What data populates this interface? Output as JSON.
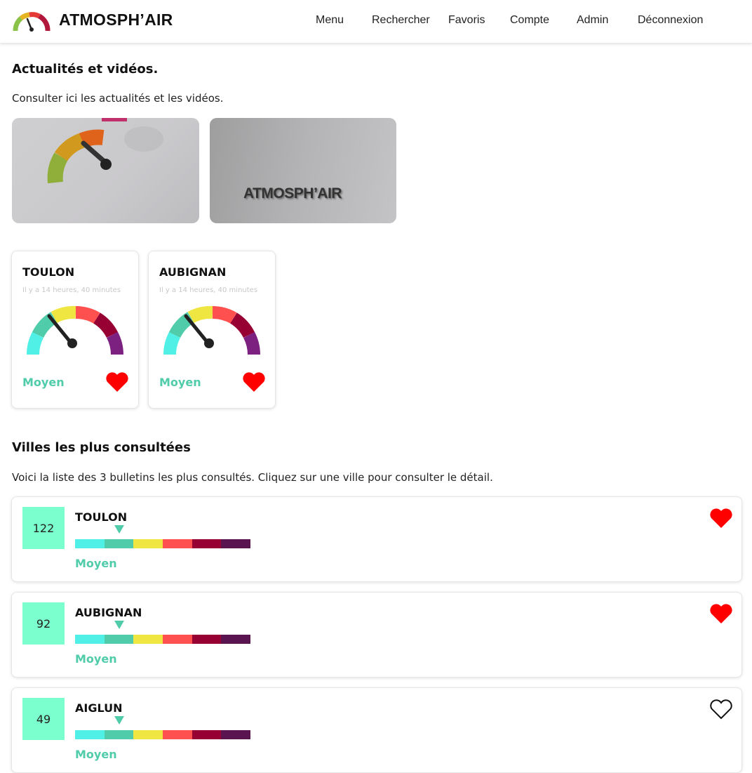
{
  "header": {
    "brand": "ATMOSPH’AIR",
    "nav": [
      "Menu",
      "Rechercher",
      "Favoris",
      "Compte",
      "Admin",
      "Déconnexion"
    ]
  },
  "news": {
    "title": "Actualités et vidéos.",
    "description": "Consulter ici les actualités et les vidéos.",
    "videos": [
      {
        "caption": ""
      },
      {
        "caption": "ATMOSPH’AIR"
      }
    ]
  },
  "favorites": [
    {
      "city": "TOULON",
      "time": "Il y a 14 heures, 40 minutes",
      "level": "Moyen",
      "favorite": true,
      "heart_icon": "heart-filled-icon"
    },
    {
      "city": "AUBIGNAN",
      "time": "Il y a 14 heures, 40 minutes",
      "level": "Moyen",
      "favorite": true,
      "heart_icon": "heart-filled-icon"
    }
  ],
  "popular": {
    "title": "Villes les plus consultées",
    "description": "Voici la liste des 3 bulletins les plus consultés. Cliquez sur une ville pour consulter le détail.",
    "items": [
      {
        "score": "122",
        "city": "TOULON",
        "level": "Moyen",
        "favorite": true
      },
      {
        "score": "92",
        "city": "AUBIGNAN",
        "level": "Moyen",
        "favorite": true
      },
      {
        "score": "49",
        "city": "AIGLUN",
        "level": "Moyen",
        "favorite": false
      }
    ]
  },
  "colors": {
    "scale": [
      "#50f0e6",
      "#50ccaa",
      "#f0e641",
      "#ff5050",
      "#960032",
      "#7d2181"
    ],
    "level_text": "#50ccaa",
    "score_bg": "#7cffcf",
    "heart": "#ff0000"
  }
}
